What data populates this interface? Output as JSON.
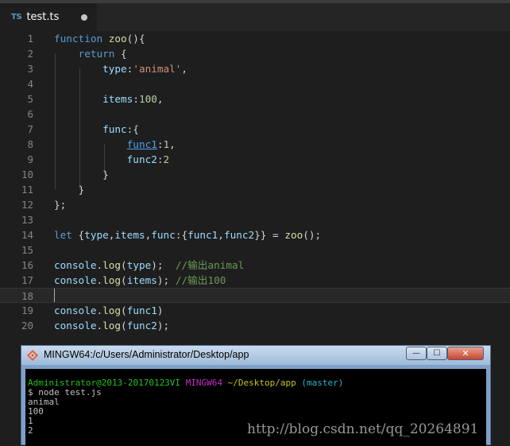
{
  "tab": {
    "icon": "TS",
    "filename": "test.ts"
  },
  "editor": {
    "line_numbers": [
      "1",
      "2",
      "3",
      "4",
      "5",
      "6",
      "7",
      "8",
      "9",
      "10",
      "11",
      "12",
      "13",
      "14",
      "15",
      "16",
      "17",
      "18",
      "19",
      "20"
    ],
    "code": {
      "l1_kw": "function",
      "l1_fn": "zoo",
      "l1_rest": "(){",
      "l2_kw": "return",
      "l2_rest": " {",
      "l3_prop": "type",
      "l3_colon": ":",
      "l3_str": "'animal'",
      "l3_comma": ",",
      "l5_prop": "items",
      "l5_colon": ":",
      "l5_num": "100",
      "l5_comma": ",",
      "l7_prop": "func",
      "l7_rest": ":{",
      "l8_prop": "func1",
      "l8_colon": ":",
      "l8_num": "1",
      "l8_comma": ",",
      "l9_prop": "func2",
      "l9_colon": ":",
      "l9_num": "2",
      "l10": "}",
      "l11": "}",
      "l12": "};",
      "l14_kw": "let",
      "l14_open": " {",
      "l14_type": "type",
      "l14_c1": ",",
      "l14_items": "items",
      "l14_c2": ",",
      "l14_func": "func",
      "l14_c3": ":{",
      "l14_func1": "func1",
      "l14_c4": ",",
      "l14_func2": "func2",
      "l14_c5": "}} = ",
      "l14_fn": "zoo",
      "l14_end": "();",
      "l16_obj": "console",
      "l16_dot": ".",
      "l16_fn": "log",
      "l16_open": "(",
      "l16_arg": "type",
      "l16_close": ");  ",
      "l16_cm": "//输出animal",
      "l17_obj": "console",
      "l17_dot": ".",
      "l17_fn": "log",
      "l17_open": "(",
      "l17_arg": "items",
      "l17_close": "); ",
      "l17_cm": "//输出100",
      "l19_obj": "console",
      "l19_dot": ".",
      "l19_fn": "log",
      "l19_open": "(",
      "l19_arg": "func1",
      "l19_close": ")",
      "l20_obj": "console",
      "l20_dot": ".",
      "l20_fn": "log",
      "l20_open": "(",
      "l20_arg": "func2",
      "l20_close": ");"
    }
  },
  "terminal": {
    "title": "MINGW64:/c/Users/Administrator/Desktop/app",
    "min_label": "—",
    "max_label": "☐",
    "close_label": "✕",
    "prompt_user": "Administrator@2013-20170123VI",
    "prompt_env": "MINGW64",
    "prompt_path": "~/Desktop/app",
    "prompt_branch": "(master)",
    "command": "$ node test.js",
    "output": [
      "animal",
      "100",
      "1",
      "2"
    ]
  },
  "watermark": "http://blog.csdn.net/qq_20264891",
  "colors": {
    "editor_bg": "#1e1e1e",
    "keyword": "#569cd6",
    "function": "#dcdcaa",
    "property": "#9cdcfe",
    "string": "#ce9178",
    "number": "#b5cea8",
    "comment": "#6a9955"
  }
}
